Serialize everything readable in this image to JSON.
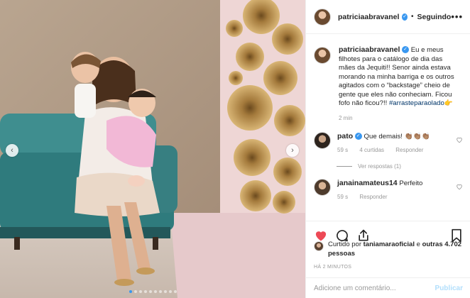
{
  "post": {
    "author": "patriciaabravanel",
    "follow_label": "Seguindo",
    "more_label": "•••",
    "caption": "Eu e meus filhotes para o catálogo de dia das mães da Jequiti!! Senor ainda estava morando na minha barriga e os outros agitados com o “backstage” cheio de gente que eles não conheciam. Ficou fofo não ficou?!!",
    "hashtag": "#arrasteparaolado",
    "hashtag_emoji": "👉",
    "caption_time": "2 min",
    "carousel": {
      "prev_icon": "‹",
      "next_icon": "›",
      "dot_count": 10,
      "active_index": 0
    }
  },
  "comments": [
    {
      "user": "pato",
      "verified": true,
      "text": "Que demais! 👏🏽👏🏽👏🏽",
      "time": "59 s",
      "likes": "4 curtidas",
      "reply": "Responder"
    },
    {
      "user": "janainamateus14",
      "verified": false,
      "text": "Perfeito",
      "time": "59 s",
      "reply": "Responder"
    }
  ],
  "view_replies": "Ver respostas (1)",
  "likes": {
    "prefix": "Curtido por",
    "by": "taniamaraoficial",
    "joiner": "e",
    "others": "outras 4.702 pessoas"
  },
  "posted_ago": "HÁ 2 MINUTOS",
  "comment_box": {
    "placeholder": "Adicione um comentário...",
    "publish": "Publicar"
  },
  "colors": {
    "like_red": "#ed4956",
    "verified_blue": "#3897f0",
    "hashtag_blue": "#003569",
    "publish_disabled": "#b2dffc"
  }
}
